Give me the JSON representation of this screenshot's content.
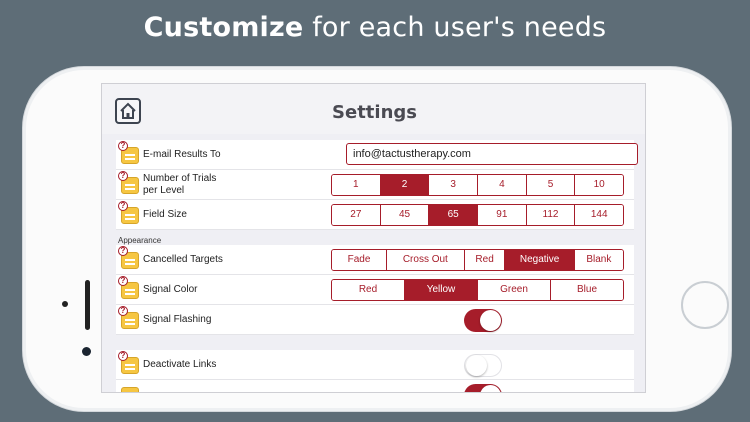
{
  "headline": {
    "bold": "Customize",
    "rest": " for each user's needs"
  },
  "nav": {
    "title": "Settings"
  },
  "rows": {
    "email": {
      "label": "E-mail Results To",
      "value": "info@tactustherapy.com"
    },
    "trials": {
      "label_line1": "Number of Trials",
      "label_line2": "per Level",
      "options": [
        "1",
        "2",
        "3",
        "4",
        "5",
        "10"
      ],
      "selected": "2"
    },
    "field": {
      "label": "Field Size",
      "options": [
        "27",
        "45",
        "65",
        "91",
        "112",
        "144"
      ],
      "selected": "65"
    },
    "appearance_header": "Appearance",
    "cancelled": {
      "label": "Cancelled Targets",
      "options": [
        "Fade",
        "Cross Out",
        "Red",
        "Negative",
        "Blank"
      ],
      "selected": "Negative"
    },
    "signal_color": {
      "label": "Signal Color",
      "options": [
        "Red",
        "Yellow",
        "Green",
        "Blue"
      ],
      "selected": "Yellow"
    },
    "signal_flashing": {
      "label": "Signal Flashing",
      "on": true
    },
    "deactivate_links": {
      "label": "Deactivate Links",
      "on": false
    }
  },
  "help_glyph": "?",
  "colors": {
    "accent": "#a61d2a",
    "background": "#5e6d77",
    "icon": "#f6c642"
  }
}
